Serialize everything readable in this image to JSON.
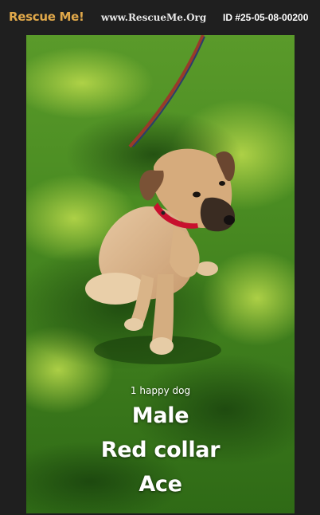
{
  "header": {
    "brand": "Rescue Me!",
    "site": "www.RescueMe.Org",
    "pet_id": "ID #25-05-08-00200"
  },
  "photo": {
    "subject": "dog-photo",
    "caption_small": "1 happy dog",
    "caption_lines": [
      "Male",
      "Red collar",
      "Ace"
    ]
  },
  "colors": {
    "background": "#1f1f1f",
    "brand": "#e0a84a",
    "grass": "#3d7a1e",
    "collar": "#c8102e"
  }
}
